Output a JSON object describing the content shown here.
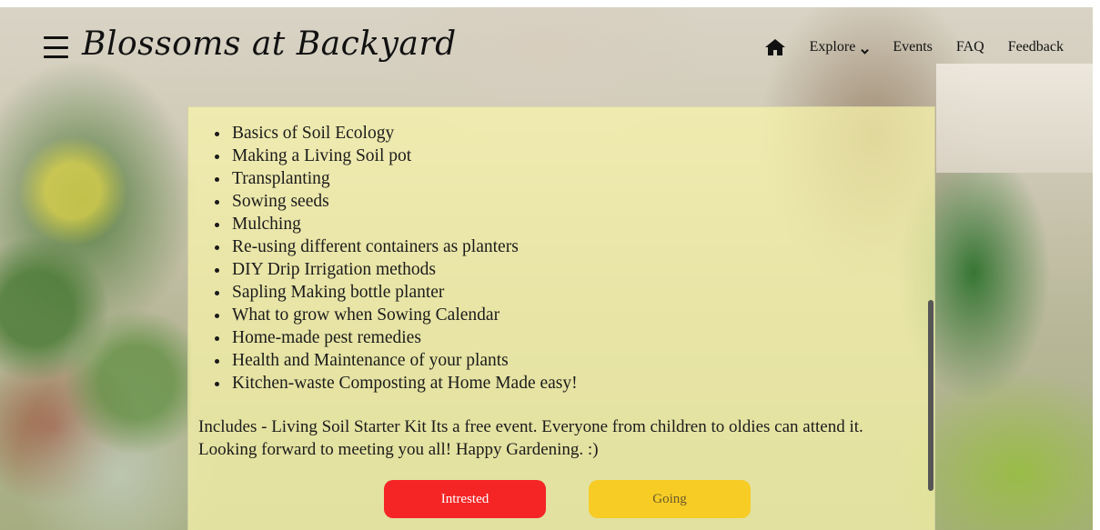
{
  "brand": {
    "title": "Blossoms at Backyard"
  },
  "nav": {
    "home_icon": "home-icon",
    "explore_label": "Explore",
    "events_label": "Events",
    "faq_label": "FAQ",
    "feedback_label": "Feedback"
  },
  "content": {
    "topics": [
      "Basics of  Soil Ecology",
      "Making a Living Soil pot",
      "Transplanting",
      "Sowing seeds",
      "Mulching",
      "Re-using different containers as planters",
      "DIY Drip Irrigation methods",
      "Sapling Making bottle planter",
      "What to grow when Sowing Calendar",
      "Home-made pest remedies",
      "Health and Maintenance of  your plants",
      "Kitchen-waste Composting at Home Made easy!"
    ],
    "description": "Includes - Living Soil Starter Kit Its a free event. Everyone from children to oldies can attend it. Looking forward to meeting you all! Happy Gardening. :)"
  },
  "actions": {
    "interested_label": "Intrested",
    "going_label": "Going"
  },
  "colors": {
    "interested": "#f52525",
    "going": "#f7cc25",
    "card_overlay": "#faf5aa"
  }
}
